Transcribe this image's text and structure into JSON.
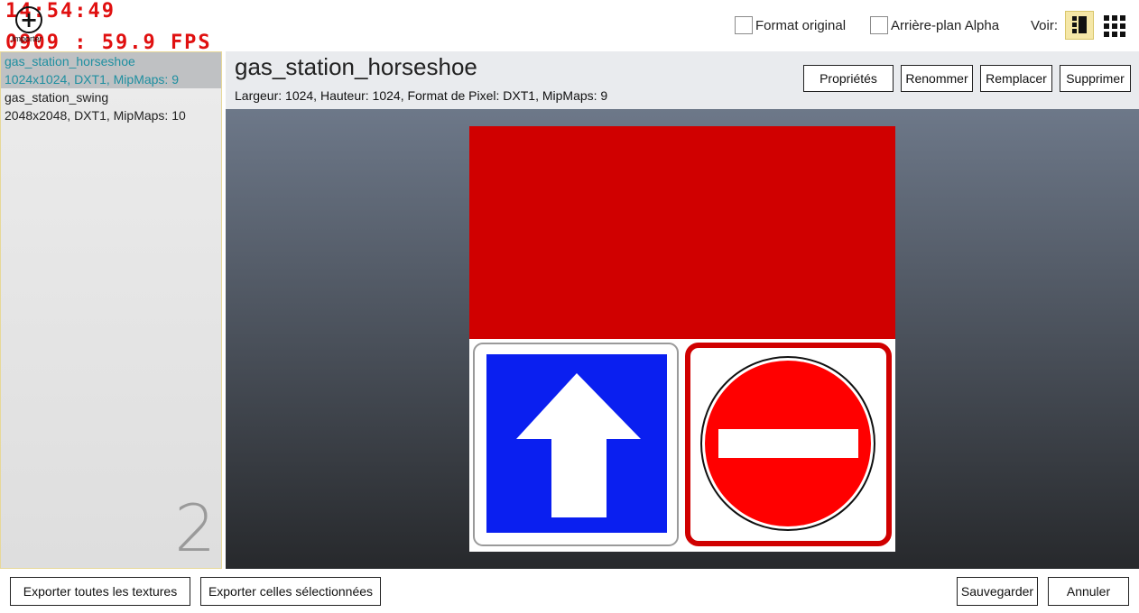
{
  "debug": {
    "time": "14:54:49",
    "fps_line": "0909 : 59.9 FPS",
    "add_label": "Importer"
  },
  "toolbar": {
    "format_original": "Format original",
    "alpha_background": "Arrière-plan Alpha",
    "view_label": "Voir:",
    "view_icons": [
      "list-detail-view-icon",
      "grid-view-icon"
    ]
  },
  "textures": [
    {
      "name": "gas_station_horseshoe",
      "info": "1024x1024, DXT1, MipMaps: 9",
      "selected": true
    },
    {
      "name": "gas_station_swing",
      "info": "2048x2048, DXT1, MipMaps: 10",
      "selected": false
    }
  ],
  "texture_count": "2",
  "selected": {
    "title": "gas_station_horseshoe",
    "details": "Largeur: 1024, Hauteur: 1024, Format de Pixel: DXT1, MipMaps: 9"
  },
  "actions": {
    "properties": "Propriétés",
    "rename": "Renommer",
    "replace": "Remplacer",
    "delete": "Supprimer"
  },
  "footer": {
    "export_all": "Exporter toutes les textures",
    "export_selected": "Exporter celles sélectionnées",
    "save": "Sauvegarder",
    "cancel": "Annuler"
  },
  "colors": {
    "accent_selected": "#1f8fa0",
    "debug": "#e01010",
    "texture_red": "#d00000",
    "sign_blue": "#0a1ff0",
    "sign_red": "#ff0000"
  }
}
